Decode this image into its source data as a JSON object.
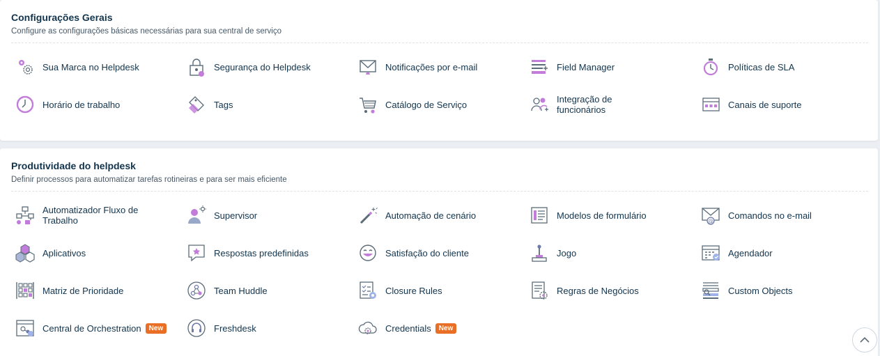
{
  "general": {
    "title": "Configurações Gerais",
    "subtitle": "Configure as configurações básicas necessárias para sua central de serviço",
    "items": [
      {
        "label": "Sua Marca no Helpdesk",
        "icon": "branding-gears-icon"
      },
      {
        "label": "Segurança do Helpdesk",
        "icon": "security-lock-icon"
      },
      {
        "label": "Notificações por e-mail",
        "icon": "email-notification-icon"
      },
      {
        "label": "Field Manager",
        "icon": "field-manager-icon"
      },
      {
        "label": "Políticas de SLA",
        "icon": "sla-timer-icon"
      },
      {
        "label": "Horário de trabalho",
        "icon": "clock-icon"
      },
      {
        "label": "Tags",
        "icon": "tag-icon"
      },
      {
        "label": "Catálogo de Serviço",
        "icon": "cart-icon"
      },
      {
        "label": "Integração de funcionários",
        "icon": "onboarding-people-icon"
      },
      {
        "label": "Canais de suporte",
        "icon": "support-channels-icon"
      }
    ]
  },
  "productivity": {
    "title": "Produtividade do helpdesk",
    "subtitle": "Definir processos para automatizar tarefas rotineiras e para ser mais eficiente",
    "items": [
      {
        "label": "Automatizador Fluxo de Trabalho",
        "icon": "workflow-icon"
      },
      {
        "label": "Supervisor",
        "icon": "supervisor-icon"
      },
      {
        "label": "Automação de cenário",
        "icon": "magic-wand-icon"
      },
      {
        "label": "Modelos de formulário",
        "icon": "form-template-icon"
      },
      {
        "label": "Comandos no e-mail",
        "icon": "email-command-icon"
      },
      {
        "label": "Aplicativos",
        "icon": "apps-cubes-icon"
      },
      {
        "label": "Respostas predefinidas",
        "icon": "canned-response-icon"
      },
      {
        "label": "Satisfação do cliente",
        "icon": "smiley-icon"
      },
      {
        "label": "Jogo",
        "icon": "joystick-icon"
      },
      {
        "label": "Agendador",
        "icon": "scheduler-icon"
      },
      {
        "label": "Matriz de Prioridade",
        "icon": "priority-matrix-icon"
      },
      {
        "label": "Team Huddle",
        "icon": "team-huddle-icon"
      },
      {
        "label": "Closure Rules",
        "icon": "closure-rules-icon"
      },
      {
        "label": "Regras de Negócios",
        "icon": "business-rules-icon"
      },
      {
        "label": "Custom Objects",
        "icon": "custom-objects-icon"
      },
      {
        "label": "Central de Orchestration",
        "icon": "orchestration-icon",
        "badge": "New"
      },
      {
        "label": "Freshdesk",
        "icon": "freshdesk-icon"
      },
      {
        "label": "Credentials",
        "icon": "credentials-icon",
        "badge": "New"
      }
    ]
  },
  "scroll_top": {
    "icon": "chevron-up-icon"
  },
  "colors": {
    "accent": "#c27cd9",
    "badge": "#e86f25",
    "text": "#12344d",
    "icon_stroke": "#5b6b78"
  }
}
